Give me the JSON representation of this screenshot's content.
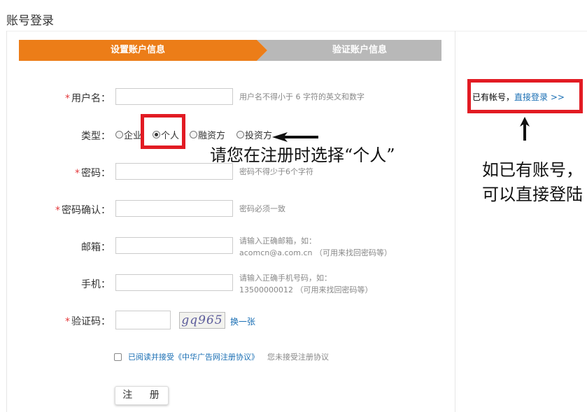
{
  "page_title": "账号登录",
  "steps": [
    "设置账户信息",
    "验证账户信息"
  ],
  "form": {
    "username": {
      "required": "*",
      "label": "用户名：",
      "hint": "用户名不得小于 6 字符的英文和数字"
    },
    "type": {
      "label": "类型：",
      "options": [
        "企业",
        "个人",
        "融资方",
        "投资方"
      ],
      "selected": "个人"
    },
    "password": {
      "required": "*",
      "label": "密码：",
      "hint": "密码不得少于6个字符"
    },
    "confirm": {
      "required": "*",
      "label": "密码确认：",
      "hint": "密码必须一致"
    },
    "email": {
      "label": "邮箱：",
      "hint_line1": "请输入正确邮箱，如：",
      "hint_line2": "acomcn@a.com.cn （可用来找回密码等）"
    },
    "phone": {
      "label": "手机：",
      "hint_line1": "请输入正确手机号码，如：",
      "hint_line2": "13500000012 （可用来找回密码等）"
    },
    "captcha": {
      "required": "*",
      "label": "验证码：",
      "image_text": "gq965",
      "refresh": "换一张"
    },
    "agreement": {
      "link": "已阅读并接受《中华广告网注册协议》",
      "note": "您未接受注册协议"
    },
    "submit": "注 册"
  },
  "sidebar": {
    "prefix": "已有帐号，",
    "login_link": "直接登录 >>"
  },
  "annotations": {
    "left": "请您在注册时选择“个人”",
    "right": "如已有账号，可以直接登陆"
  },
  "colors": {
    "accent": "#ec7d18",
    "highlight_box": "#e21b23",
    "link": "#1a6fb4"
  }
}
